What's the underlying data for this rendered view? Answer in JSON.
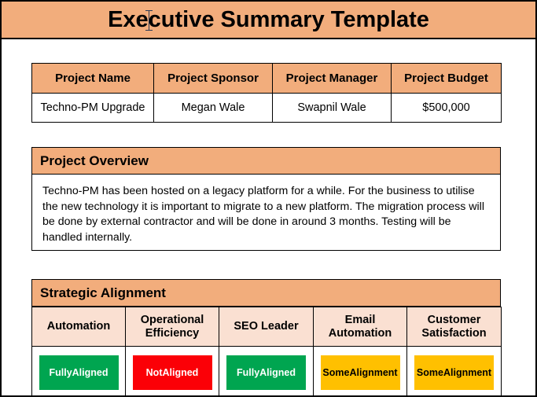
{
  "document": {
    "title": "Executive Summary Template",
    "accent_band_color": "#f2ad7c",
    "header_tint_color": "#fae0d2",
    "border_color": "#000000"
  },
  "project_info": {
    "headers": [
      "Project Name",
      "Project Sponsor",
      "Project Manager",
      "Project Budget"
    ],
    "row": [
      "Techno-PM Upgrade",
      "Megan Wale",
      "Swapnil Wale",
      "$500,000"
    ]
  },
  "project_overview": {
    "heading": "Project Overview",
    "body": "Techno-PM has been hosted on a legacy platform for a while.  For the business to utilise the new technology it is important to migrate to a new platform. The migration process will be done by external contractor and will be done in around 3 months. Testing will be handled internally."
  },
  "strategic_alignment": {
    "heading": "Strategic Alignment",
    "columns": [
      {
        "label": "Automation",
        "status": "Fully Aligned",
        "status_line1": "Fully",
        "status_line2": "Aligned",
        "color": "#00a550",
        "text_color": "#ffffff"
      },
      {
        "label": "Operational Efficiency",
        "status": "Not Aligned",
        "status_line1": "Not",
        "status_line2": "Aligned",
        "color": "#fb0007",
        "text_color": "#ffffff"
      },
      {
        "label": "SEO Leader",
        "status": "Fully Aligned",
        "status_line1": "Fully",
        "status_line2": "Aligned",
        "color": "#00a550",
        "text_color": "#ffffff"
      },
      {
        "label": "Email Automation",
        "status": "Some Alignment",
        "status_line1": "Some",
        "status_line2": "Alignment",
        "color": "#ffc000",
        "text_color": "#000000"
      },
      {
        "label": "Customer Satisfaction",
        "status": "Some Alignment",
        "status_line1": "Some",
        "status_line2": "Alignment",
        "color": "#ffc000",
        "text_color": "#000000"
      }
    ]
  }
}
